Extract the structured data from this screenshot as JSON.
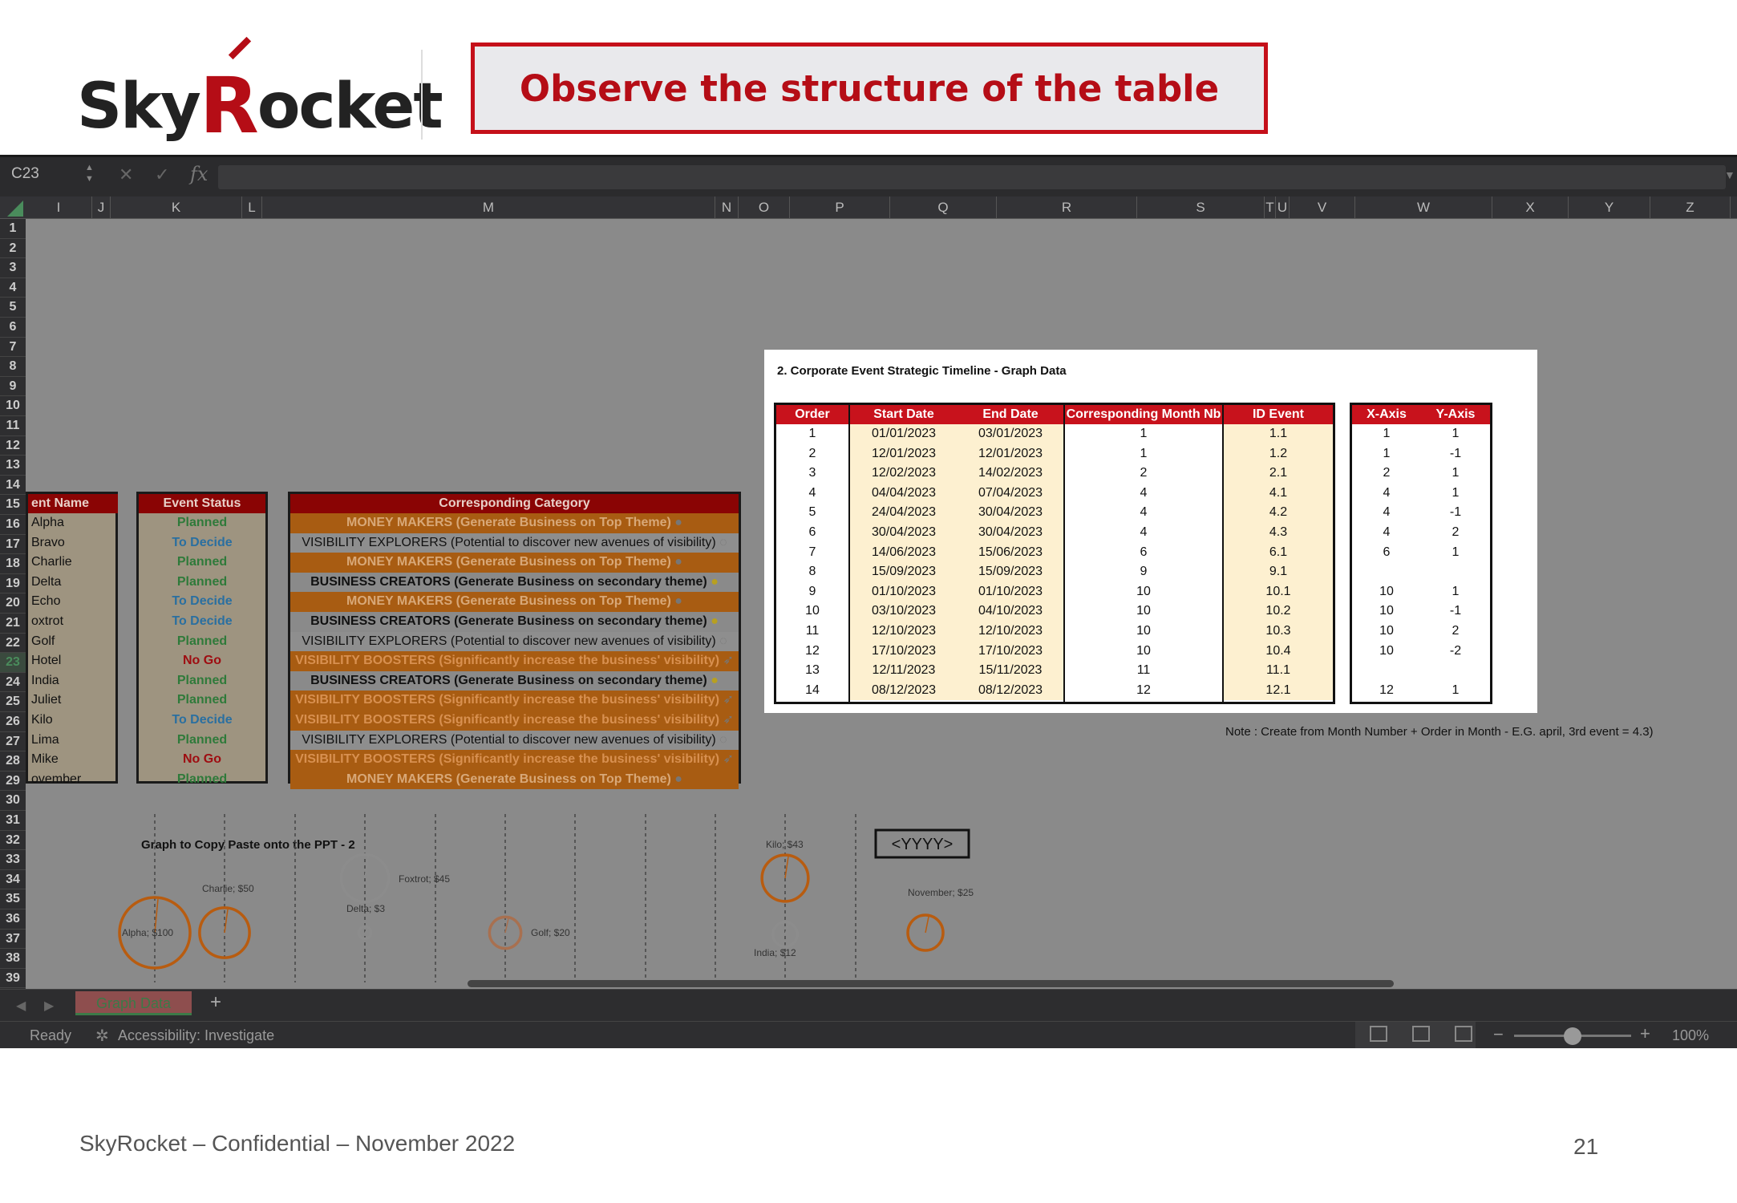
{
  "slide": {
    "logo_text": "SkyRocket",
    "title": "Observe the structure of the table",
    "footer": "SkyRocket – Confidential – November 2022",
    "page_number": "21",
    "brand_color": "#c5101a"
  },
  "excel": {
    "name_box": "C23",
    "fx_label": "fx",
    "columns": [
      "I",
      "J",
      "K",
      "L",
      "M",
      "N",
      "O",
      "P",
      "Q",
      "R",
      "S",
      "T",
      "U",
      "V",
      "W",
      "X",
      "Y",
      "Z"
    ],
    "rows": [
      "1",
      "2",
      "3",
      "4",
      "5",
      "6",
      "7",
      "8",
      "9",
      "10",
      "11",
      "12",
      "13",
      "14",
      "15",
      "16",
      "17",
      "18",
      "19",
      "20",
      "21",
      "22",
      "23",
      "24",
      "25",
      "26",
      "27",
      "28",
      "29",
      "30",
      "31",
      "32",
      "33",
      "34",
      "35",
      "36",
      "37",
      "38",
      "39"
    ],
    "event_name_header": "ent Name",
    "event_names": [
      "Alpha",
      "Bravo",
      "Charlie",
      "Delta",
      "Echo",
      "oxtrot",
      "Golf",
      "Hotel",
      "India",
      "Juliet",
      "Kilo",
      "Lima",
      "Mike",
      "ovember"
    ],
    "event_status_header": "Event Status",
    "event_statuses": [
      {
        "text": "Planned",
        "color": "#2f7a3a"
      },
      {
        "text": "To Decide",
        "color": "#2a6fa0"
      },
      {
        "text": "Planned",
        "color": "#2f7a3a"
      },
      {
        "text": "Planned",
        "color": "#2f7a3a"
      },
      {
        "text": "To Decide",
        "color": "#2a6fa0"
      },
      {
        "text": "To Decide",
        "color": "#2a6fa0"
      },
      {
        "text": "Planned",
        "color": "#2f7a3a"
      },
      {
        "text": "No Go",
        "color": "#9e0c10"
      },
      {
        "text": "Planned",
        "color": "#2f7a3a"
      },
      {
        "text": "Planned",
        "color": "#2f7a3a"
      },
      {
        "text": "To Decide",
        "color": "#2a6fa0"
      },
      {
        "text": "Planned",
        "color": "#2f7a3a"
      },
      {
        "text": "No Go",
        "color": "#9e0c10"
      },
      {
        "text": "Planned",
        "color": "#2f7a3a"
      }
    ],
    "category_header": "Corresponding Category",
    "categories": [
      {
        "text": "MONEY MAKERS (Generate Business on Top Theme)",
        "kind": "money",
        "icon": "coin-icon"
      },
      {
        "text": "VISIBILITY EXPLORERS (Potential to discover new avenues of visibility)",
        "kind": "vexp",
        "icon": "compass-icon"
      },
      {
        "text": "MONEY MAKERS (Generate Business on Top Theme)",
        "kind": "money",
        "icon": "coin-icon"
      },
      {
        "text": "BUSINESS CREATORS (Generate Business on secondary theme)",
        "kind": "bcre",
        "icon": "money-bag-icon"
      },
      {
        "text": "MONEY MAKERS (Generate Business on Top Theme)",
        "kind": "money",
        "icon": "coin-icon"
      },
      {
        "text": "BUSINESS CREATORS (Generate Business on secondary theme)",
        "kind": "bcre",
        "icon": "money-bag-icon"
      },
      {
        "text": "VISIBILITY EXPLORERS (Potential to discover new avenues of visibility)",
        "kind": "vexp",
        "icon": "compass-icon"
      },
      {
        "text": "VISIBILITY BOOSTERS (Significantly increase the business' visibility)",
        "kind": "vboost",
        "icon": "rocket-icon"
      },
      {
        "text": "BUSINESS CREATORS (Generate Business on secondary theme)",
        "kind": "bcre",
        "icon": "money-bag-icon"
      },
      {
        "text": "VISIBILITY BOOSTERS (Significantly increase the business' visibility)",
        "kind": "vboost",
        "icon": "rocket-icon"
      },
      {
        "text": "VISIBILITY BOOSTERS (Significantly increase the business' visibility)",
        "kind": "vboost",
        "icon": "rocket-icon"
      },
      {
        "text": "VISIBILITY EXPLORERS (Potential to discover new avenues of visibility)",
        "kind": "vexp",
        "icon": "compass-icon"
      },
      {
        "text": "VISIBILITY BOOSTERS (Significantly increase the business' visibility)",
        "kind": "vboost",
        "icon": "rocket-icon"
      },
      {
        "text": "MONEY MAKERS (Generate Business on Top Theme)",
        "kind": "money",
        "icon": "coin-icon"
      }
    ],
    "panel": {
      "title": "2. Corporate Event Strategic Timeline - Graph Data",
      "headers": [
        "Order",
        "Start Date",
        "End Date",
        "Corresponding Month Nb",
        "ID Event"
      ],
      "order": [
        "1",
        "2",
        "3",
        "4",
        "5",
        "6",
        "7",
        "8",
        "9",
        "10",
        "11",
        "12",
        "13",
        "14"
      ],
      "start": [
        "01/01/2023",
        "12/01/2023",
        "12/02/2023",
        "04/04/2023",
        "24/04/2023",
        "30/04/2023",
        "14/06/2023",
        "15/09/2023",
        "01/10/2023",
        "03/10/2023",
        "12/10/2023",
        "17/10/2023",
        "12/11/2023",
        "08/12/2023"
      ],
      "end": [
        "03/01/2023",
        "12/01/2023",
        "14/02/2023",
        "07/04/2023",
        "30/04/2023",
        "30/04/2023",
        "15/06/2023",
        "15/09/2023",
        "01/10/2023",
        "04/10/2023",
        "12/10/2023",
        "17/10/2023",
        "15/11/2023",
        "08/12/2023"
      ],
      "month": [
        "1",
        "1",
        "2",
        "4",
        "4",
        "4",
        "6",
        "9",
        "10",
        "10",
        "10",
        "10",
        "11",
        "12"
      ],
      "id": [
        "1.1",
        "1.2",
        "2.1",
        "4.1",
        "4.2",
        "4.3",
        "6.1",
        "9.1",
        "10.1",
        "10.2",
        "10.3",
        "10.4",
        "11.1",
        "12.1"
      ],
      "xy_headers": [
        "X-Axis",
        "Y-Axis"
      ],
      "x": [
        "1",
        "1",
        "2",
        "4",
        "4",
        "4",
        "6",
        "",
        "10",
        "10",
        "10",
        "10",
        "",
        "12"
      ],
      "y": [
        "1",
        "-1",
        "1",
        "1",
        "-1",
        "2",
        "1",
        "",
        "1",
        "-1",
        "2",
        "-2",
        "",
        "1"
      ]
    },
    "note": "Note : Create from Month Number + Order in Month - E.G. april, 3rd event = 4.3)",
    "graph_label": "Graph to Copy Paste onto the PPT - 2",
    "sheet_tab": "Graph Data",
    "status_ready": "Ready",
    "status_accessibility": "Accessibility: Investigate",
    "zoom": "100%"
  },
  "chart_data": {
    "type": "scatter",
    "placeholder": "<YYYY>",
    "bubbles": [
      {
        "label": "Alpha; $100",
        "value": 100,
        "color": "#b85c10"
      },
      {
        "label": "Charlie; $50",
        "value": 50,
        "color": "#b85c10"
      },
      {
        "label": "Delta; $3",
        "value": 3,
        "color": "#8c8c8c"
      },
      {
        "label": "Foxtrot; $45",
        "value": 45,
        "color": "#8c8c8c"
      },
      {
        "label": "Golf; $20",
        "value": 20,
        "color": "#a87050"
      },
      {
        "label": "Kilo; $43",
        "value": 43,
        "color": "#b85c10"
      },
      {
        "label": "India; $12",
        "value": 12,
        "color": "#8c8c8c"
      },
      {
        "label": "November; $25",
        "value": 25,
        "color": "#b85c10"
      }
    ]
  }
}
